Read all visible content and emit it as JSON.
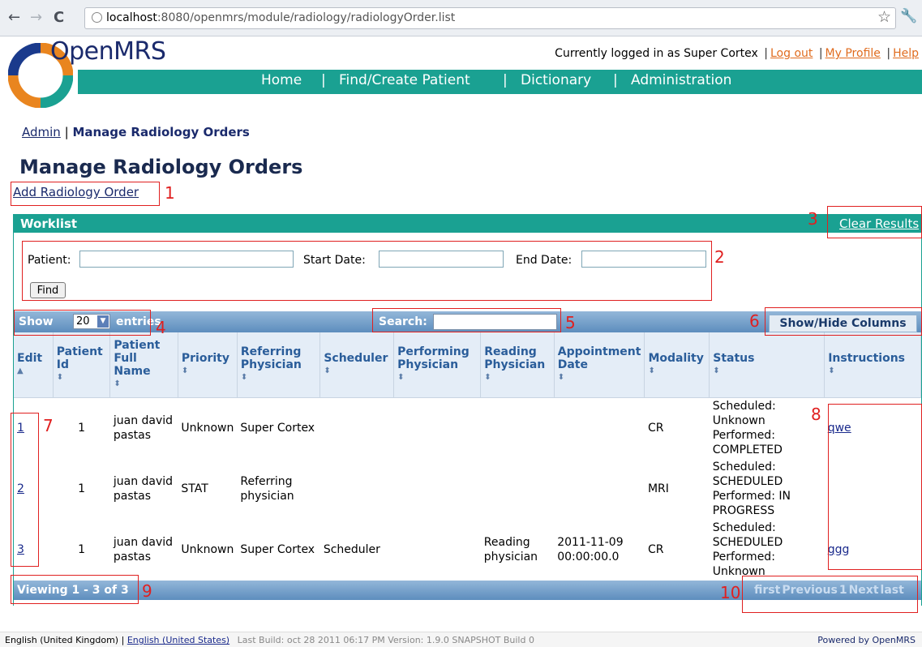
{
  "browser": {
    "url_host": "localhost",
    "url_path": ":8080/openmrs/module/radiology/radiologyOrder.list",
    "back_icon": "back-arrow-icon",
    "forward_icon": "forward-arrow-icon",
    "reload_icon": "reload-icon"
  },
  "header": {
    "logo_text": "OpenMRS",
    "logged_in_text": "Currently logged in as Super Cortex",
    "logout": "Log out",
    "my_profile": "My Profile",
    "help": "Help",
    "sep": "|"
  },
  "nav": {
    "home": "Home",
    "find_patient": "Find/Create Patient",
    "dictionary": "Dictionary",
    "administration": "Administration",
    "sep": "|"
  },
  "breadcrumb": {
    "admin": "Admin",
    "sep": "|",
    "current": "Manage Radiology Orders"
  },
  "page_title": "Manage Radiology Orders",
  "add_order": "Add Radiology Order",
  "worklist": {
    "title": "Worklist",
    "clear_results": "Clear Results",
    "patient_label": "Patient:",
    "start_date_label": "Start Date:",
    "end_date_label": "End Date:",
    "find_button": "Find"
  },
  "table_toolbar": {
    "show": "Show",
    "entries_value": "20",
    "entries": "entries",
    "search": "Search:",
    "show_hide": "Show/Hide Columns"
  },
  "columns": [
    "Edit",
    "Patient Id",
    "Patient Full Name",
    "Priority",
    "Referring Physician",
    "Scheduler",
    "Performing Physician",
    "Reading Physician",
    "Appointment Date",
    "Modality",
    "Status",
    "Instructions"
  ],
  "rows": [
    {
      "edit": "1",
      "patient_id": "1",
      "name": "juan david pastas",
      "priority": "Unknown",
      "referring": "Super Cortex",
      "scheduler": "",
      "performing": "",
      "reading": "",
      "appointment": "",
      "modality": "CR",
      "status": "Scheduled: Unknown Performed: COMPLETED",
      "instructions": "qwe"
    },
    {
      "edit": "2",
      "patient_id": "1",
      "name": "juan david pastas",
      "priority": "STAT",
      "referring": "Referring physician",
      "scheduler": "",
      "performing": "",
      "reading": "",
      "appointment": "",
      "modality": "MRI",
      "status": "Scheduled: SCHEDULED Performed: IN PROGRESS",
      "instructions": ""
    },
    {
      "edit": "3",
      "patient_id": "1",
      "name": "juan david pastas",
      "priority": "Unknown",
      "referring": "Super Cortex",
      "scheduler": "Scheduler",
      "performing": "",
      "reading": "Reading physician",
      "appointment": "2011-11-09 00:00:00.0",
      "modality": "CR",
      "status": "Scheduled: SCHEDULED Performed: Unknown",
      "instructions": "ggg"
    }
  ],
  "table_footer": {
    "viewing": "Viewing 1 - 3 of 3",
    "first": "first",
    "previous": "Previous",
    "page": "1",
    "next": "Next",
    "last": "last"
  },
  "annotations": [
    "1",
    "2",
    "3",
    "4",
    "5",
    "6",
    "7",
    "8",
    "9",
    "10"
  ],
  "footer": {
    "lang_current": "English (United Kingdom)",
    "sep": "|",
    "lang_other": "English (United States)",
    "build": "Last Build: oct 28 2011 06:17 PM  Version: 1.9.0 SNAPSHOT Build 0",
    "powered": "Powered by OpenMRS"
  },
  "colors": {
    "brand_teal": "#1aa192",
    "link_orange": "#e06c1f",
    "annotation_red": "#e02020",
    "table_blue": "#5d8dbd"
  }
}
